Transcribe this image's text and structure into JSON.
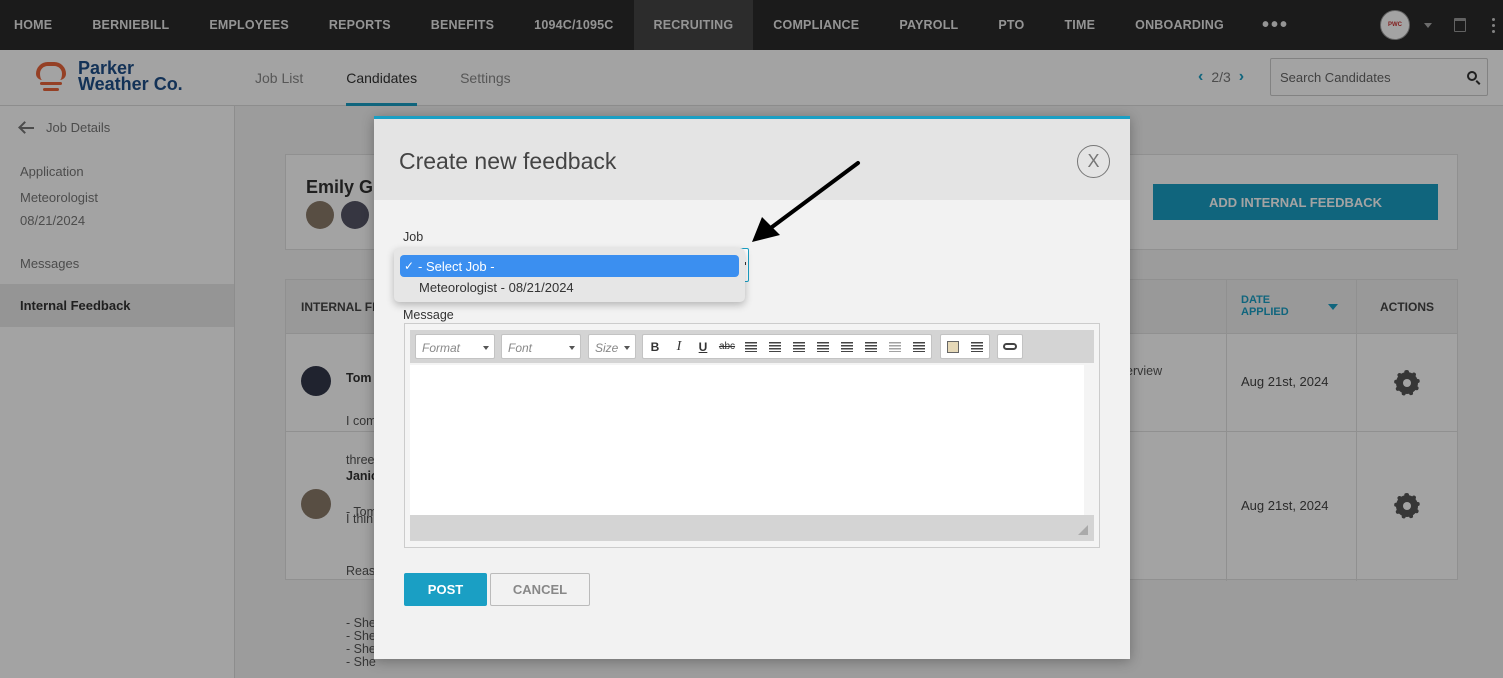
{
  "topnav": {
    "items": [
      "HOME",
      "BERNIEBILL",
      "EMPLOYEES",
      "REPORTS",
      "BENEFITS",
      "1094C/1095C",
      "RECRUITING",
      "COMPLIANCE",
      "PAYROLL",
      "PTO",
      "TIME",
      "ONBOARDING"
    ],
    "active": "RECRUITING",
    "more": "•••"
  },
  "brand": {
    "line1": "Parker",
    "line2": "Weather Co.",
    "color": "#1f4f88",
    "accent": "#e9643a"
  },
  "subtabs": [
    "Job List",
    "Candidates",
    "Settings"
  ],
  "pager": {
    "text": "2/3"
  },
  "search": {
    "placeholder": "Search Candidates"
  },
  "sidebar": {
    "back": "Job Details",
    "application_label": "Application",
    "job": "Meteorologist",
    "date": "08/21/2024",
    "messages": "Messages",
    "internal_feedback": "Internal Feedback"
  },
  "candidate": {
    "name": "Emily G"
  },
  "main": {
    "add_feedback": "ADD INTERNAL FEEDBACK",
    "col_internal": "INTERNAL FE",
    "col_date_1": "DATE",
    "col_date_2": "APPLIED",
    "col_actions": "ACTIONS",
    "rows": [
      {
        "name": "Tom",
        "l1": "I com",
        "l2": "three",
        "l3": "- Tom",
        "date": "Aug 21st, 2024",
        "extra": "erview"
      },
      {
        "name": "Janic",
        "l1": "I thin",
        "l2": "Reas",
        "l3": "- She\n- She\n- She\n- She",
        "date": "Aug 21st, 2024"
      }
    ]
  },
  "modal": {
    "title": "Create new feedback",
    "close": "X",
    "job_label": "Job",
    "options": [
      "- Select Job -",
      "Meteorologist - 08/21/2024"
    ],
    "selected": "- Select Job -",
    "check": "✓",
    "message_label": "Message",
    "toolbar": {
      "format": "Format",
      "font": "Font",
      "size": "Size",
      "bold": "B",
      "italic": "I",
      "underline": "U",
      "strike": "abc"
    },
    "post": "POST",
    "cancel": "CANCEL"
  },
  "colors": {
    "accent": "#1a9fc4",
    "nav_bg": "#2b2b2b",
    "select_highlight": "#3b8ff0"
  }
}
